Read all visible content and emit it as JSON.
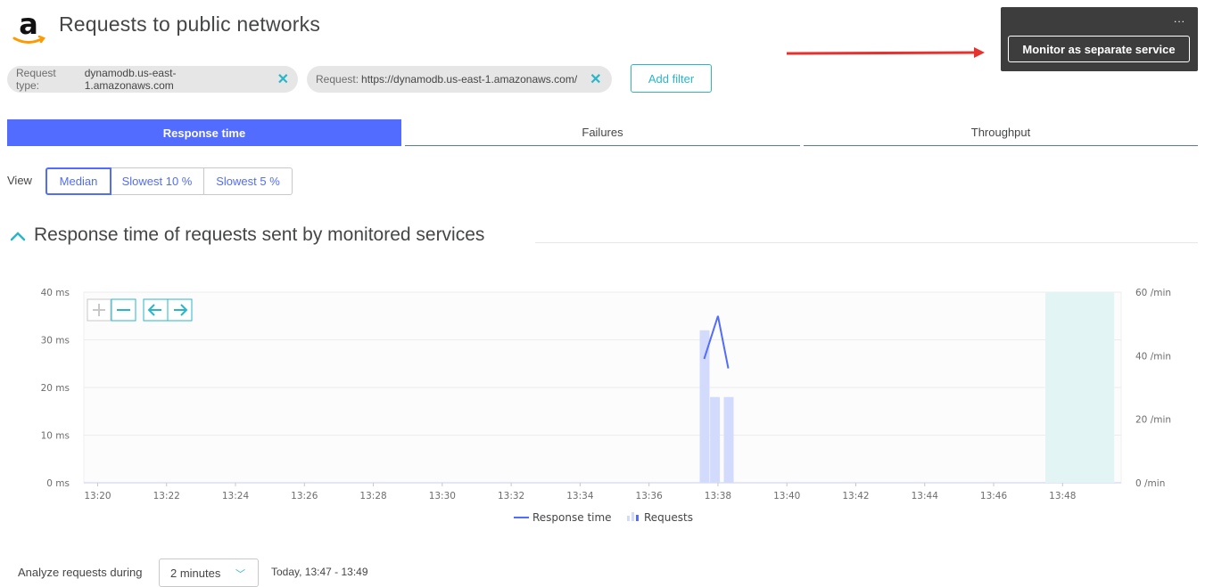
{
  "header": {
    "title": "Requests to public networks",
    "logo_icon": "amazon-logo"
  },
  "filters": [
    {
      "key": "Request type:",
      "value": "dynamodb.us-east-1.amazonaws.com"
    },
    {
      "key": "Request:",
      "value": "https://dynamodb.us-east-1.amazonaws.com/"
    }
  ],
  "add_filter_label": "Add filter",
  "menu": {
    "dots": "...",
    "monitor_label": "Monitor as separate service"
  },
  "tabs": [
    {
      "label": "Response time",
      "active": true
    },
    {
      "label": "Failures",
      "active": false
    },
    {
      "label": "Throughput",
      "active": false
    }
  ],
  "view": {
    "label": "View",
    "options": [
      "Median",
      "Slowest 10 %",
      "Slowest 5 %"
    ],
    "selected": "Median"
  },
  "section_title": "Response time of requests sent by monitored services",
  "colors": {
    "accent": "#526cff",
    "teal": "#2ab6c9",
    "bars": "#d3dbfd"
  },
  "chart_data": {
    "type": "line",
    "x_ticks": [
      "13:20",
      "13:22",
      "13:24",
      "13:26",
      "13:28",
      "13:30",
      "13:32",
      "13:34",
      "13:36",
      "13:38",
      "13:40",
      "13:42",
      "13:44",
      "13:46",
      "13:48"
    ],
    "y_left_ticks": [
      "0 ms",
      "10 ms",
      "20 ms",
      "30 ms",
      "40 ms"
    ],
    "y_left_range": [
      0,
      40
    ],
    "y_right_ticks": [
      "0 /min",
      "20 /min",
      "40 /min",
      "60 /min"
    ],
    "y_right_range": [
      0,
      60
    ],
    "grid": true,
    "legend_position": "bottom",
    "series": [
      {
        "name": "Response time",
        "type": "line",
        "axis": "left",
        "x": [
          "13:37.6",
          "13:38.0",
          "13:38.3"
        ],
        "values": [
          26,
          35,
          24
        ]
      },
      {
        "name": "Requests",
        "type": "bar",
        "axis": "right",
        "x": [
          "13:37.6",
          "13:37.9",
          "13:38.3"
        ],
        "values": [
          48,
          27,
          27
        ]
      }
    ],
    "highlight_range": [
      "13:47.5",
      "13:49.5"
    ]
  },
  "footer": {
    "analyze_label": "Analyze requests during",
    "duration": "2 minutes",
    "period": "Today, 13:47 - 13:49"
  }
}
